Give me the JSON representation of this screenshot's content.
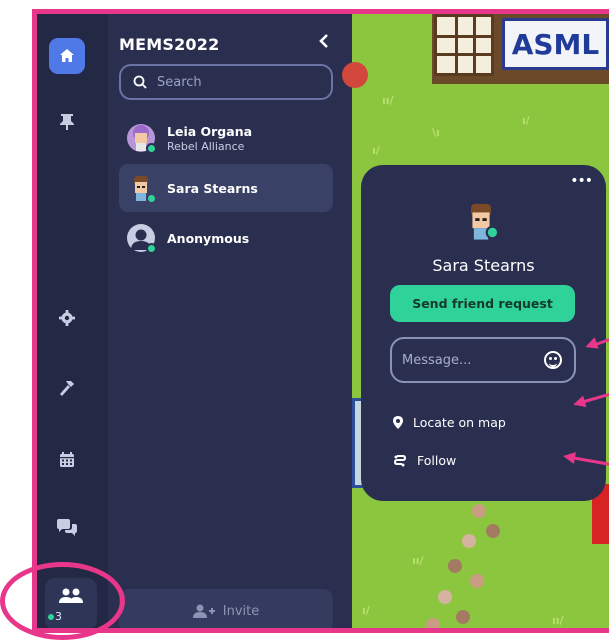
{
  "colors": {
    "accent": "#e8378a",
    "green": "#2fd39a",
    "panel": "#2a2f4f",
    "rail": "#232844",
    "home_active": "#4f79e6"
  },
  "rail": {
    "icons": [
      "home-icon",
      "pin-icon",
      "gear-icon",
      "hammer-icon",
      "calendar-icon",
      "chat-icon",
      "people-icon"
    ],
    "online_count": "3"
  },
  "panel": {
    "title": "MEMS2022",
    "search_placeholder": "Search",
    "users": [
      {
        "name": "Leia Organa",
        "subtitle": "Rebel Alliance"
      },
      {
        "name": "Sara Stearns",
        "subtitle": ""
      },
      {
        "name": "Anonymous",
        "subtitle": ""
      }
    ],
    "invite_label": "Invite"
  },
  "map": {
    "sign_text": "ASML"
  },
  "popup": {
    "name": "Sara Stearns",
    "friend_button": "Send friend request",
    "message_placeholder": "Message...",
    "locate_label": "Locate on map",
    "follow_label": "Follow"
  }
}
